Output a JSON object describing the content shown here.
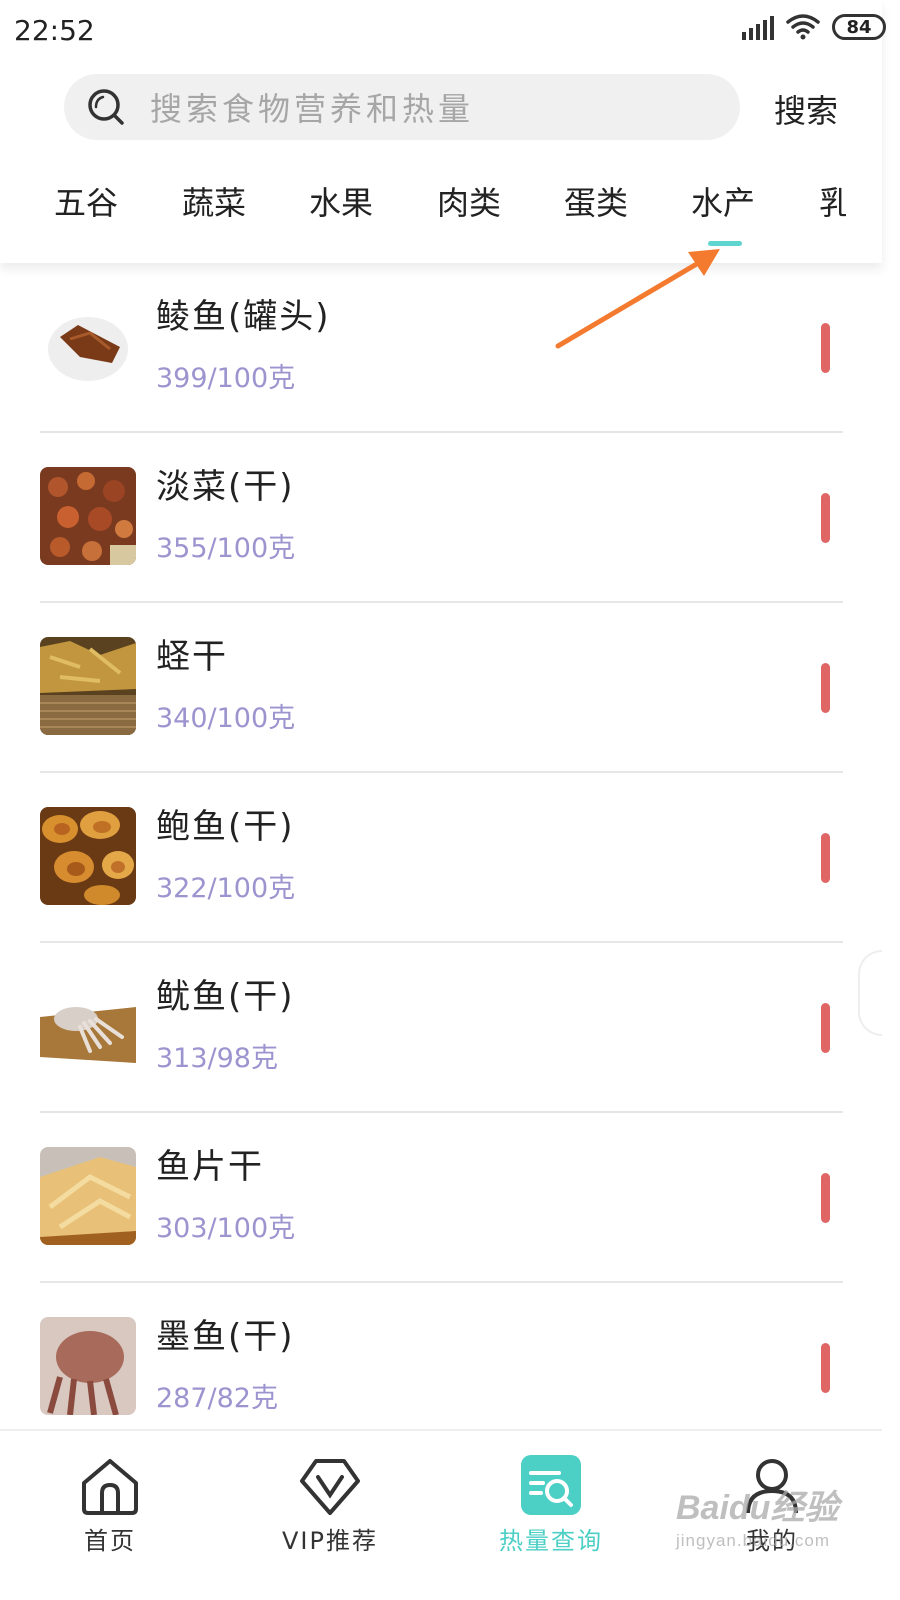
{
  "status_bar": {
    "time": "22:52",
    "battery": "84"
  },
  "search": {
    "placeholder": "搜索食物营养和热量",
    "button_label": "搜索"
  },
  "tabs": [
    {
      "label": "五谷"
    },
    {
      "label": "蔬菜"
    },
    {
      "label": "水果"
    },
    {
      "label": "肉类"
    },
    {
      "label": "蛋类"
    },
    {
      "label": "水产"
    },
    {
      "label": "乳"
    }
  ],
  "active_tab": "水产",
  "foods": [
    {
      "name": "鲮鱼(罐头)",
      "calories": "399/100克",
      "thumb_color": "#8a4a22"
    },
    {
      "name": "淡菜(干)",
      "calories": "355/100克",
      "thumb_color": "#b0552c"
    },
    {
      "name": "蛏干",
      "calories": "340/100克",
      "thumb_color": "#c2963e"
    },
    {
      "name": "鲍鱼(干)",
      "calories": "322/100克",
      "thumb_color": "#c77a2a"
    },
    {
      "name": "鱿鱼(干)",
      "calories": "313/98克",
      "thumb_color": "#b98a52"
    },
    {
      "name": "鱼片干",
      "calories": "303/100克",
      "thumb_color": "#e0b870"
    },
    {
      "name": "墨鱼(干)",
      "calories": "287/82克",
      "thumb_color": "#a86a5a"
    }
  ],
  "bottom_nav": [
    {
      "label": "首页",
      "icon": "home-icon"
    },
    {
      "label": "VIP推荐",
      "icon": "vip-icon"
    },
    {
      "label": "热量查询",
      "icon": "calorie-search-icon",
      "active": true
    },
    {
      "label": "我的",
      "icon": "profile-icon"
    }
  ],
  "watermark": {
    "main": "Baidu经验",
    "sub": "jingyan.baidu.com"
  },
  "colors": {
    "accent": "#4ccfc5",
    "calorie_text": "#9c94cf",
    "bar": "#e06666",
    "arrow": "#f37a2e"
  }
}
